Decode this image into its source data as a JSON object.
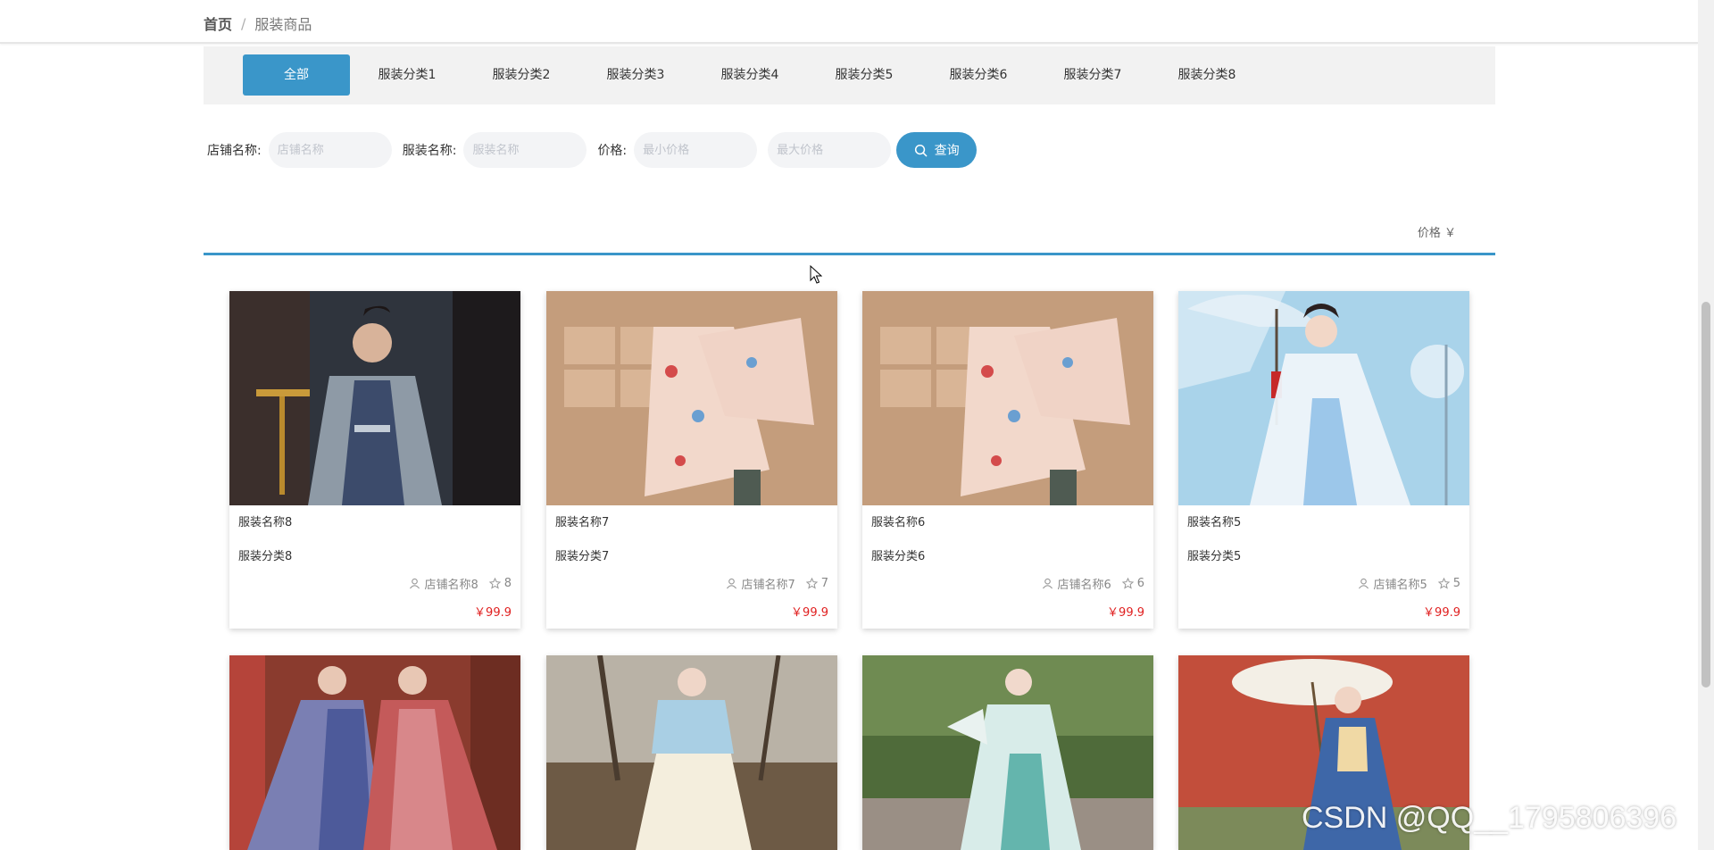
{
  "breadcrumb": {
    "home": "首页",
    "separator": "/",
    "current": "服装商品"
  },
  "categories": [
    "全部",
    "服装分类1",
    "服装分类2",
    "服装分类3",
    "服装分类4",
    "服装分类5",
    "服装分类6",
    "服装分类7",
    "服装分类8"
  ],
  "active_category": "全部",
  "search": {
    "shop_label": "店铺名称:",
    "shop_placeholder": "店铺名称",
    "name_label": "服装名称:",
    "name_placeholder": "服装名称",
    "price_label": "价格:",
    "min_placeholder": "最小价格",
    "max_placeholder": "最大价格",
    "button_label": "查询"
  },
  "sort": {
    "price_label": "价格 ￥"
  },
  "products": [
    {
      "name": "服装名称8",
      "category": "服装分类8",
      "shop": "店铺名称8",
      "favorites": "8",
      "price": "￥99.9"
    },
    {
      "name": "服装名称7",
      "category": "服装分类7",
      "shop": "店铺名称7",
      "favorites": "7",
      "price": "￥99.9"
    },
    {
      "name": "服装名称6",
      "category": "服装分类6",
      "shop": "店铺名称6",
      "favorites": "6",
      "price": "￥99.9"
    },
    {
      "name": "服装名称5",
      "category": "服装分类5",
      "shop": "店铺名称5",
      "favorites": "5",
      "price": "￥99.9"
    },
    {
      "name": "",
      "category": "",
      "shop": "",
      "favorites": "",
      "price": ""
    },
    {
      "name": "",
      "category": "",
      "shop": "",
      "favorites": "",
      "price": ""
    },
    {
      "name": "",
      "category": "",
      "shop": "",
      "favorites": "",
      "price": ""
    },
    {
      "name": "",
      "category": "",
      "shop": "",
      "favorites": "",
      "price": ""
    }
  ],
  "watermark": "CSDN @QQ__1795806396",
  "colors": {
    "accent": "#3a96c9",
    "price": "#e02020",
    "category_bar": "#f2f2f2"
  }
}
